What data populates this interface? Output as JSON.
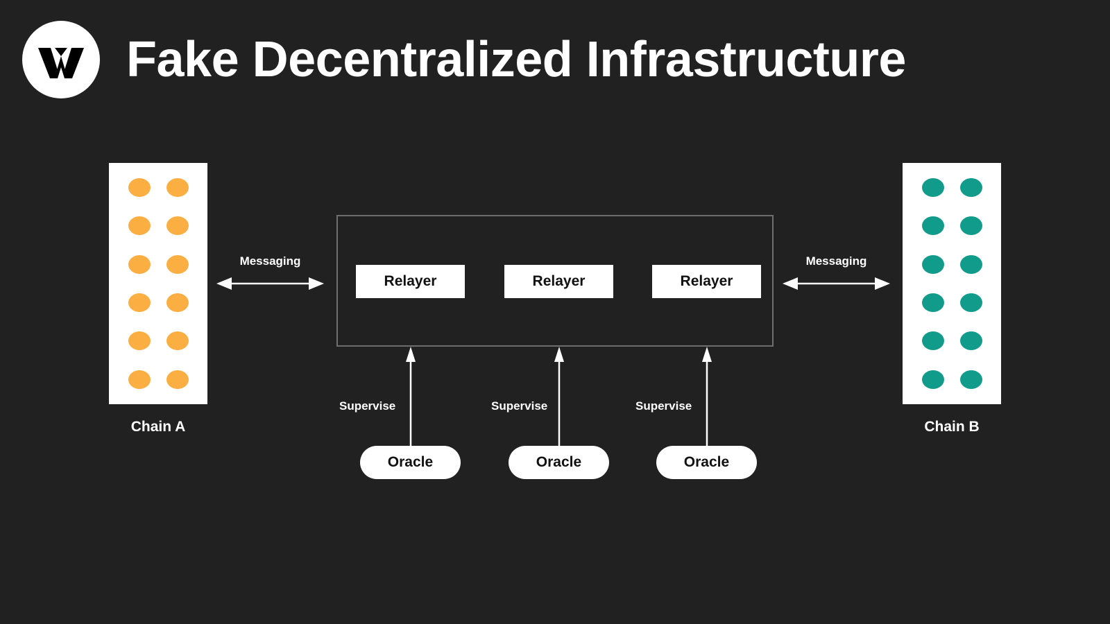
{
  "page": {
    "background_color": "#212121",
    "title": "Fake Decentralized Infrastructure"
  },
  "logo": {
    "name": "w-logo",
    "letter": "W",
    "circle_color": "#ffffff",
    "glyph_color": "#000000"
  },
  "diagram": {
    "colors": {
      "chain_a_node": "#fbae41",
      "chain_b_node": "#109b8a",
      "panel": "#ffffff",
      "container_border": "#6e6e6e",
      "arrow": "#ffffff",
      "text_on_white": "#111111",
      "text_on_dark": "#ffffff"
    },
    "chains": [
      {
        "id": "chain-a",
        "label": "Chain A",
        "side": "left",
        "node_color": "#fbae41",
        "node_rows": 6,
        "node_columns": 2,
        "node_count": 12
      },
      {
        "id": "chain-b",
        "label": "Chain B",
        "side": "right",
        "node_color": "#109b8a",
        "node_rows": 6,
        "node_columns": 2,
        "node_count": 12
      }
    ],
    "relayers": [
      {
        "id": "relayer-1",
        "label": "Relayer"
      },
      {
        "id": "relayer-2",
        "label": "Relayer"
      },
      {
        "id": "relayer-3",
        "label": "Relayer"
      }
    ],
    "oracles": [
      {
        "id": "oracle-1",
        "label": "Oracle"
      },
      {
        "id": "oracle-2",
        "label": "Oracle"
      },
      {
        "id": "oracle-3",
        "label": "Oracle"
      }
    ],
    "messaging_edges": [
      {
        "id": "messaging-left",
        "label": "Messaging",
        "direction": "bidirectional",
        "from": "Chain A",
        "to": "Relayer group"
      },
      {
        "id": "messaging-right",
        "label": "Messaging",
        "direction": "bidirectional",
        "from": "Relayer group",
        "to": "Chain B"
      }
    ],
    "supervise_edges": [
      {
        "id": "supervise-1",
        "label": "Supervise",
        "direction": "up",
        "from": "Oracle",
        "to": "Relayer"
      },
      {
        "id": "supervise-2",
        "label": "Supervise",
        "direction": "up",
        "from": "Oracle",
        "to": "Relayer"
      },
      {
        "id": "supervise-3",
        "label": "Supervise",
        "direction": "up",
        "from": "Oracle",
        "to": "Relayer"
      }
    ]
  }
}
